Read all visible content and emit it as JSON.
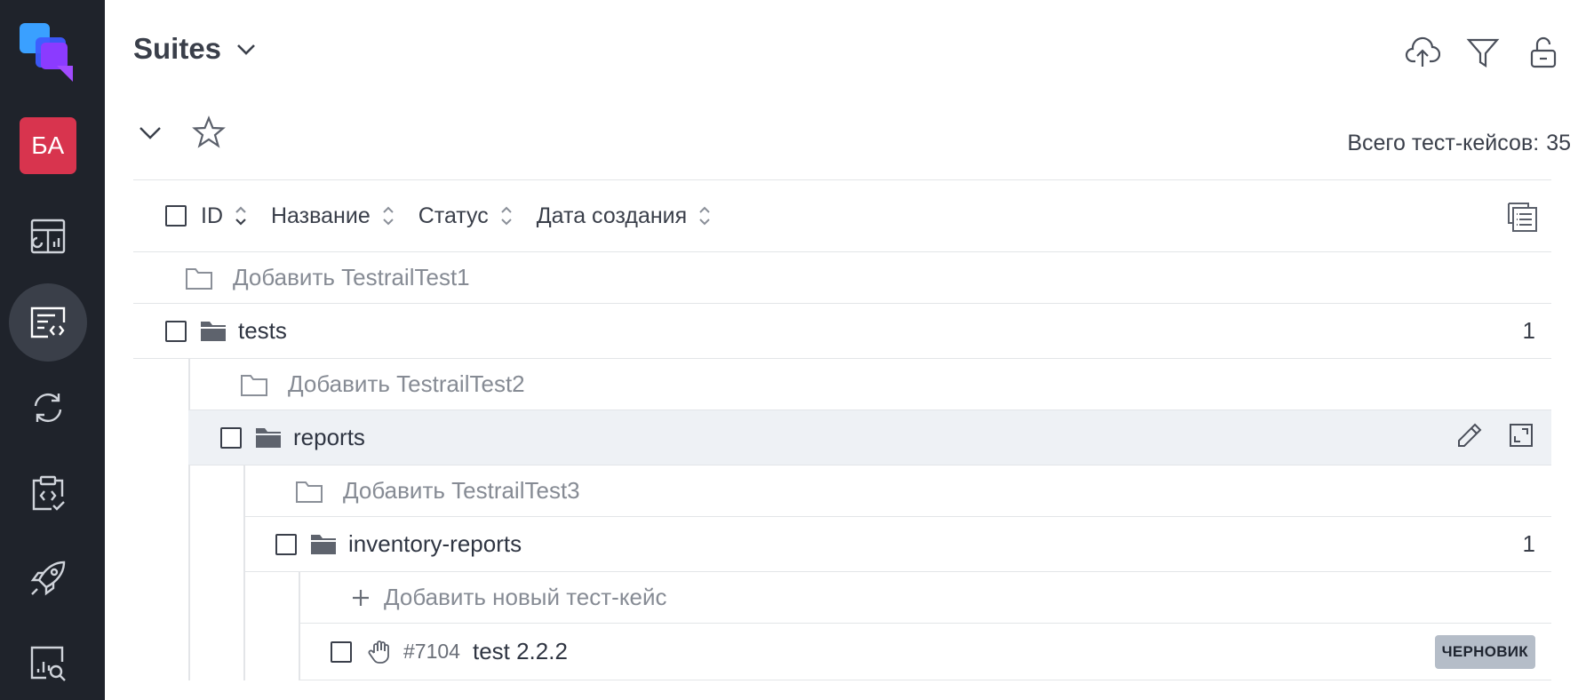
{
  "sidebar": {
    "avatar_initials": "БА",
    "items": [
      {
        "icon": "dashboard-icon"
      },
      {
        "icon": "test-cases-icon",
        "active": true
      },
      {
        "icon": "sync-icon"
      },
      {
        "icon": "test-plan-icon"
      },
      {
        "icon": "launch-icon"
      },
      {
        "icon": "analytics-icon"
      }
    ]
  },
  "header": {
    "title": "Suites",
    "actions": [
      "upload-icon",
      "filter-icon",
      "unlock-icon"
    ]
  },
  "toolbar": {
    "total_label": "Всего тест-кейсов:",
    "total_value": "35"
  },
  "columns": {
    "id": "ID",
    "name": "Название",
    "status": "Статус",
    "created": "Дата создания"
  },
  "tree": {
    "add_root": "Добавить TestrailTest1",
    "tests": {
      "name": "tests",
      "count": "1"
    },
    "add_tests": "Добавить TestrailTest2",
    "reports": {
      "name": "reports"
    },
    "add_reports": "Добавить TestrailTest3",
    "inventory": {
      "name": "inventory-reports",
      "count": "1"
    },
    "add_case": "Добавить новый тест-кейс",
    "case": {
      "id": "#7104",
      "name": "test 2.2.2",
      "status": "ЧЕРНОВИК"
    }
  },
  "colors": {
    "sidebar_bg": "#1f232b",
    "avatar_bg": "#d8344e",
    "highlight_row": "#eef1f5",
    "badge_bg": "#b5bdc8"
  }
}
